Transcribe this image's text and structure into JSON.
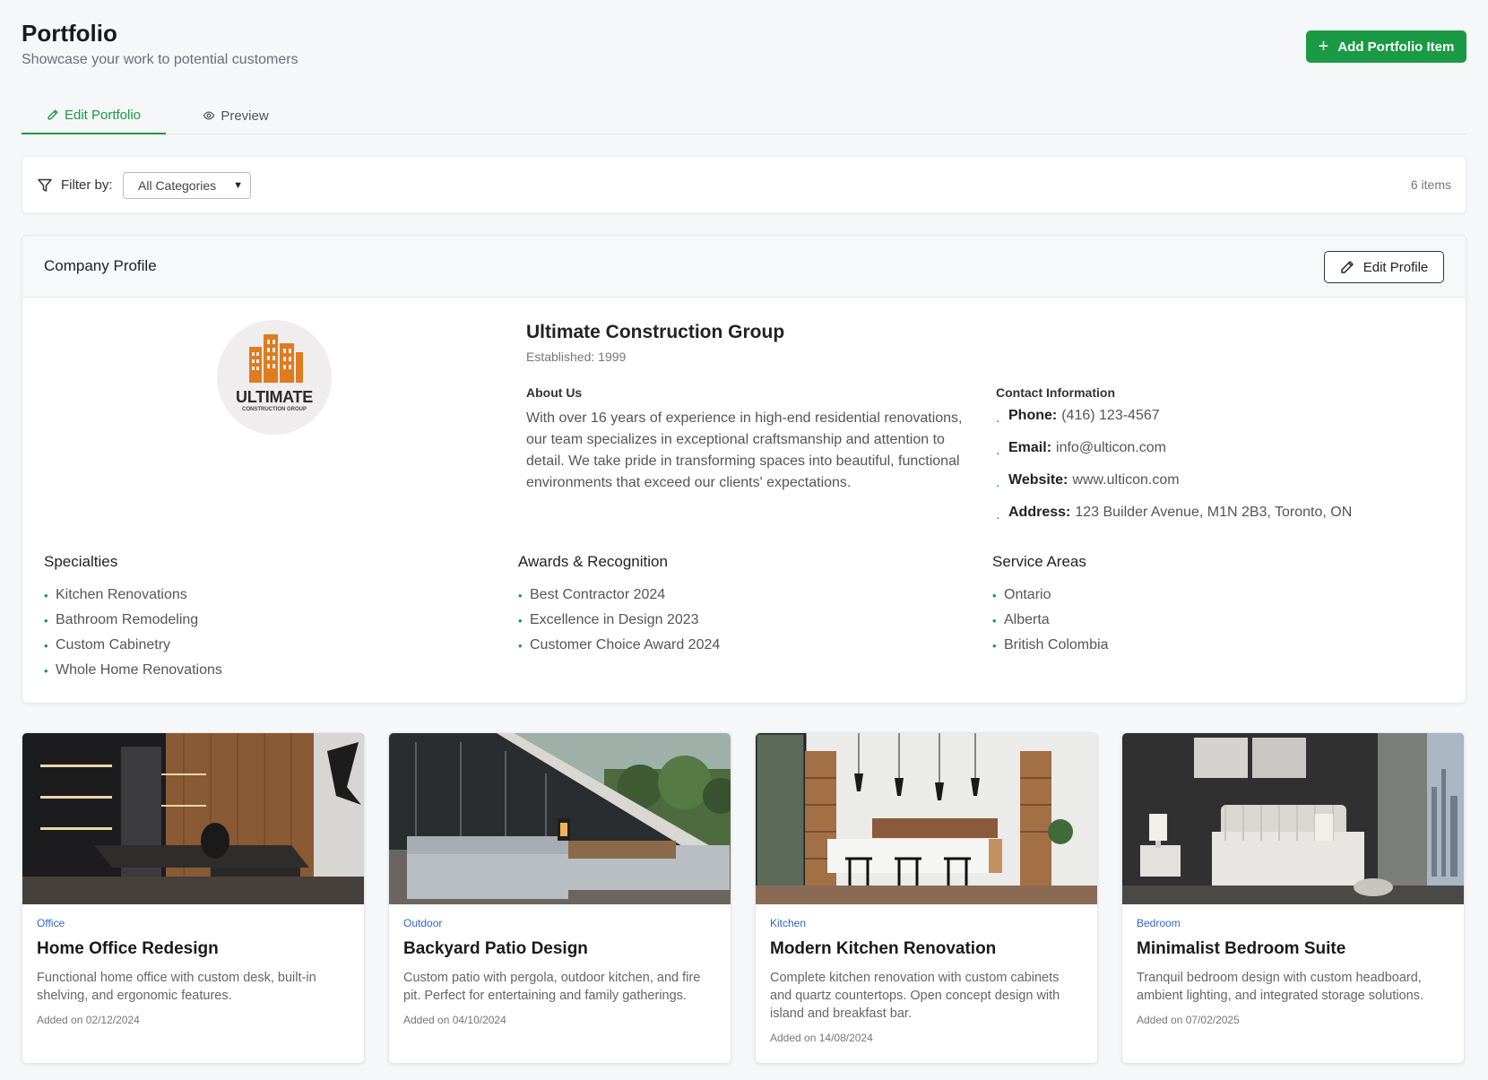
{
  "header": {
    "title": "Portfolio",
    "subtitle": "Showcase your work to potential customers",
    "add_button_label": "Add Portfolio Item"
  },
  "tabs": [
    {
      "label": "Edit Portfolio",
      "active": true
    },
    {
      "label": "Preview",
      "active": false
    }
  ],
  "filter": {
    "label": "Filter by:",
    "selected": "All Categories",
    "count": "6 items"
  },
  "profile": {
    "heading": "Company Profile",
    "edit_button_label": "Edit Profile",
    "logo_text": "ULTIMATE",
    "logo_subtext": "CONSTRUCTION GROUP",
    "company_name": "Ultimate Construction Group",
    "established": "Established: 1999",
    "about_heading": "About Us",
    "about_text": "With over 16 years of experience in high-end residential renovations, our team specializes in exceptional craftsmanship and attention to detail. We take pride in transforming spaces into beautiful, functional environments that exceed our clients' expectations.",
    "contact_heading": "Contact Information",
    "contact": [
      {
        "label": "Phone:",
        "value": "(416) 123-4567"
      },
      {
        "label": "Email:",
        "value": "info@ulticon.com"
      },
      {
        "label": "Website:",
        "value": "www.ulticon.com"
      },
      {
        "label": "Address:",
        "value": "123 Builder Avenue, M1N 2B3, Toronto, ON"
      }
    ],
    "specialties_heading": "Specialties",
    "specialties": [
      "Kitchen Renovations",
      "Bathroom Remodeling",
      "Custom Cabinetry",
      "Whole Home Renovations"
    ],
    "awards_heading": "Awards & Recognition",
    "awards": [
      "Best Contractor 2024",
      "Excellence in Design 2023",
      "Customer Choice Award 2024"
    ],
    "areas_heading": "Service Areas",
    "areas": [
      "Ontario",
      "Alberta",
      "British Colombia"
    ]
  },
  "items": [
    {
      "category": "Office",
      "title": "Home Office Redesign",
      "description": "Functional home office with custom desk, built-in shelving, and ergonomic features.",
      "date": "Added on 02/12/2024"
    },
    {
      "category": "Outdoor",
      "title": "Backyard Patio Design",
      "description": "Custom patio with pergola, outdoor kitchen, and fire pit. Perfect for entertaining and family gatherings.",
      "date": "Added on 04/10/2024"
    },
    {
      "category": "Kitchen",
      "title": "Modern Kitchen Renovation",
      "description": "Complete kitchen renovation with custom cabinets and quartz countertops. Open concept design with island and breakfast bar.",
      "date": "Added on 14/08/2024"
    },
    {
      "category": "Bedroom",
      "title": "Minimalist Bedroom Suite",
      "description": "Tranquil bedroom design with custom headboard, ambient lighting, and integrated storage solutions.",
      "date": "Added on 07/02/2025"
    }
  ],
  "colors": {
    "accent": "#1a9a44",
    "category_link": "#3366cc",
    "logo_orange": "#e07b1f"
  }
}
